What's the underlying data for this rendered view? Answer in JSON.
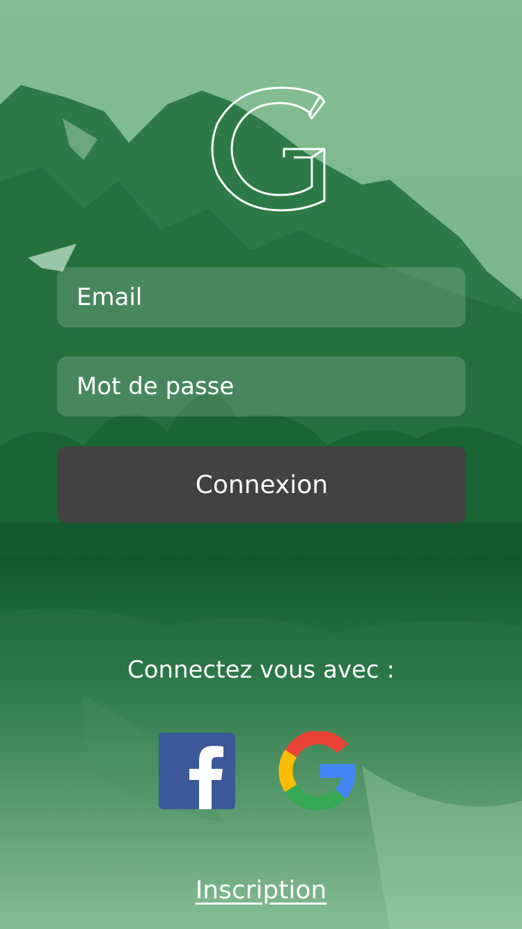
{
  "login": {
    "email_placeholder": "Email",
    "password_placeholder": "Mot de passe",
    "submit_label": "Connexion"
  },
  "social": {
    "heading": "Connectez vous avec :",
    "providers": [
      {
        "name": "facebook",
        "icon": "facebook-icon",
        "color": "#3b5998"
      },
      {
        "name": "google",
        "icon": "google-icon",
        "colors": [
          "#ea4335",
          "#fbbc05",
          "#34a853",
          "#4285f4"
        ]
      }
    ]
  },
  "signup": {
    "label": "Inscription"
  },
  "theme": {
    "background_tint": "#2e8b57",
    "button_color": "#424242",
    "text_color": "#ffffff"
  },
  "icons": {
    "logo": "g-logo-icon",
    "background": "mountain-lake-background"
  }
}
